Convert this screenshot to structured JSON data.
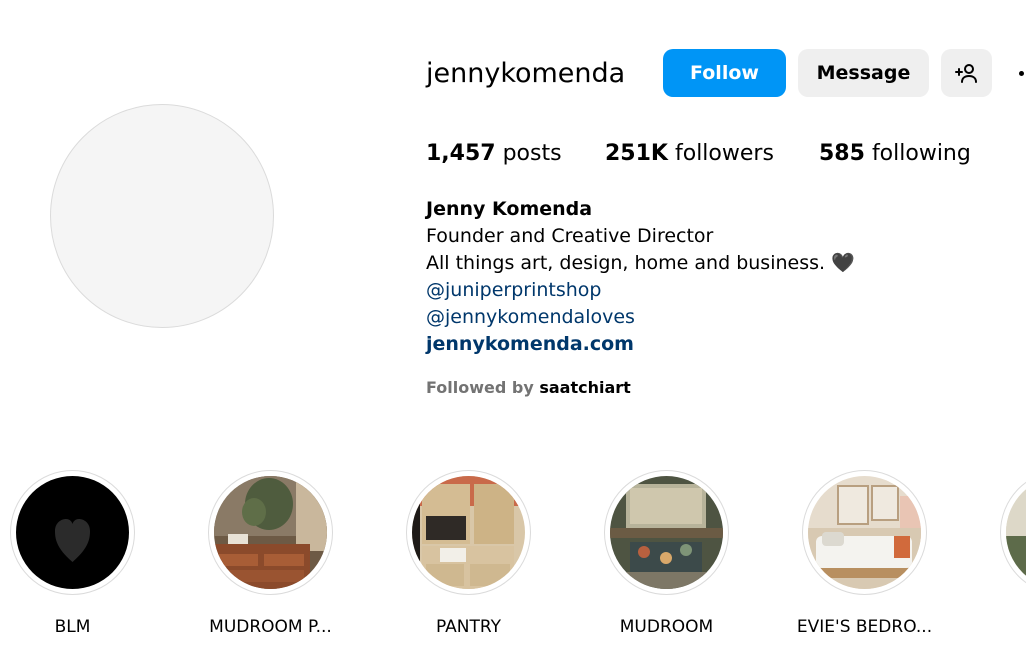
{
  "profile": {
    "username": "jennykomenda",
    "follow_label": "Follow",
    "message_label": "Message",
    "add_user_icon": "person-add-icon",
    "more_icon": "more-options-icon"
  },
  "stats": {
    "posts_count": "1,457",
    "posts_label": "posts",
    "followers_count": "251K",
    "followers_label": "followers",
    "following_count": "585",
    "following_label": "following"
  },
  "bio": {
    "full_name": "Jenny Komenda",
    "line1": "Founder and Creative Director",
    "line2": "All things art, design, home and business.",
    "line2_emoji": "🖤",
    "mention1": "@juniperprintshop",
    "mention2": "@jennykomendaloves",
    "website": "jennykomenda.com"
  },
  "followed_by": {
    "prefix": "Followed by",
    "user": "saatchiart"
  },
  "highlights": [
    {
      "label": "BLM",
      "icon": "heart-icon"
    },
    {
      "label": "MUDROOM P..."
    },
    {
      "label": "PANTRY"
    },
    {
      "label": "MUDROOM"
    },
    {
      "label": "EVIE'S BEDRO..."
    }
  ],
  "colors": {
    "accent": "#0095f6",
    "link": "#00376b",
    "secondary_button": "#efefef"
  }
}
